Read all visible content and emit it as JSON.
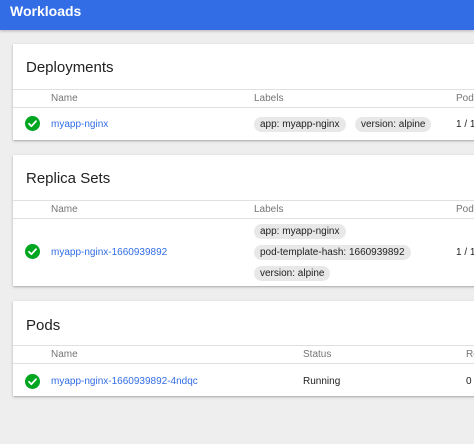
{
  "header": {
    "title": "Workloads",
    "accent_color": "#326de6"
  },
  "deployments": {
    "title": "Deployments",
    "columns": {
      "name": "Name",
      "labels": "Labels",
      "pods": "Pod"
    },
    "rows": [
      {
        "status_icon": "check-circle-icon",
        "name": "myapp-nginx",
        "labels": [
          "app: myapp-nginx",
          "version: alpine"
        ],
        "pods": "1 / 1"
      }
    ]
  },
  "replica_sets": {
    "title": "Replica Sets",
    "columns": {
      "name": "Name",
      "labels": "Labels",
      "pods": "Pod"
    },
    "rows": [
      {
        "status_icon": "check-circle-icon",
        "name": "myapp-nginx-1660939892",
        "labels": [
          "app: myapp-nginx",
          "pod-template-hash: 1660939892",
          "version: alpine"
        ],
        "pods": "1 / 1"
      }
    ]
  },
  "pods": {
    "title": "Pods",
    "columns": {
      "name": "Name",
      "status": "Status",
      "restarts": "Re"
    },
    "rows": [
      {
        "status_icon": "check-circle-icon",
        "name": "myapp-nginx-1660939892-4ndqc",
        "status": "Running",
        "restarts": "0"
      }
    ]
  },
  "colors": {
    "success": "#00a520",
    "link": "#326de6",
    "chip_bg": "#e8e8e8"
  }
}
